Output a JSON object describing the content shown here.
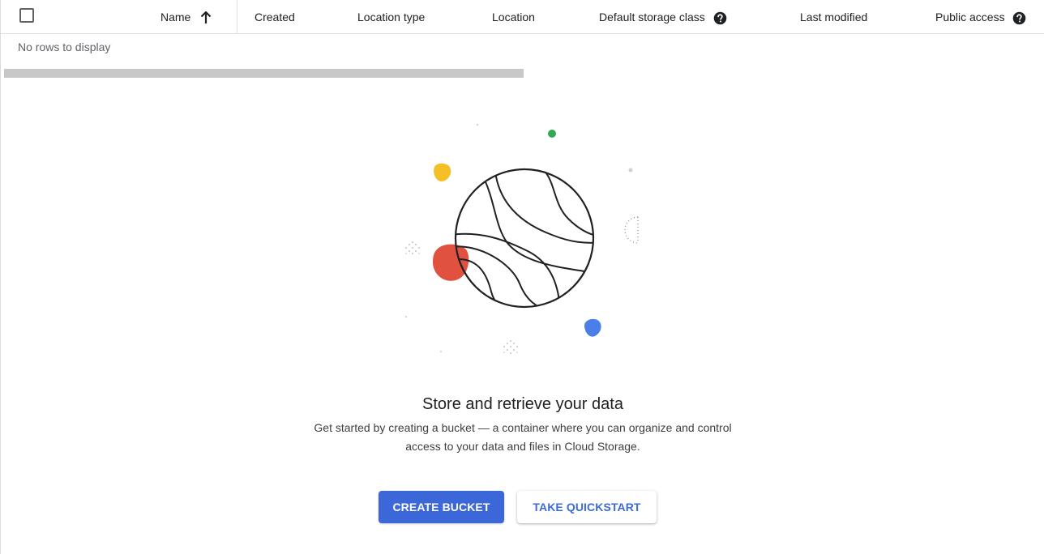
{
  "table": {
    "columns": [
      {
        "label": "Name",
        "sort": "ascending"
      },
      {
        "label": "Created"
      },
      {
        "label": "Location type"
      },
      {
        "label": "Location"
      },
      {
        "label": "Default storage class",
        "help": true
      },
      {
        "label": "Last modified"
      },
      {
        "label": "Public access",
        "help": true
      }
    ],
    "empty_message": "No rows to display"
  },
  "empty_state": {
    "title": "Store and retrieve your data",
    "description": "Get started by creating a bucket — a container where you can organize and control access to your data and files in Cloud Storage.",
    "primary_button": "CREATE BUCKET",
    "secondary_button": "TAKE QUICKSTART"
  },
  "icons": {
    "sort": "arrow-upward-icon",
    "help": "help-circle-icon",
    "checkbox": "checkbox-unchecked-icon",
    "illustration": "globe-illustration"
  },
  "colors": {
    "primary": "#3b67d8",
    "link_text": "#3c6ad9",
    "illustration_red": "#e0513f",
    "illustration_yellow": "#f4c026",
    "illustration_green": "#34a853",
    "illustration_blue": "#4a7fe8"
  }
}
